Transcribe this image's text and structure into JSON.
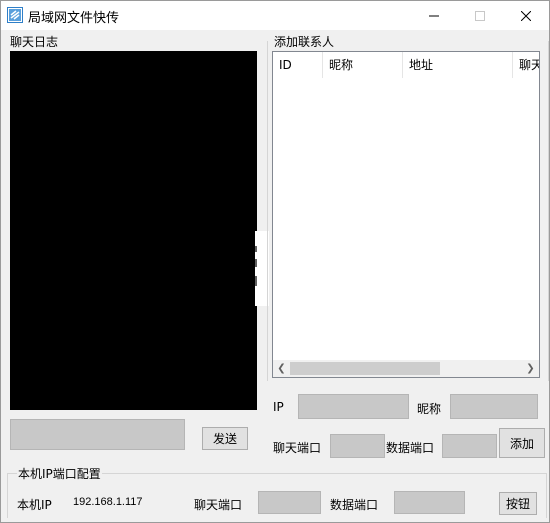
{
  "window": {
    "title": "局域网文件快传"
  },
  "chat_log": {
    "label": "聊天日志",
    "send_label": "发送"
  },
  "contacts": {
    "label": "添加联系人",
    "columns": [
      "ID",
      "昵称",
      "地址",
      "聊天"
    ],
    "ip_label": "IP",
    "nick_label": "昵称",
    "chat_port_label": "聊天端口",
    "data_port_label": "数据端口",
    "add_label": "添加"
  },
  "local_config": {
    "label": "本机IP端口配置",
    "ip_label": "本机IP",
    "ip_value": "192.168.1.117",
    "chat_port_label": "聊天端口",
    "data_port_label": "数据端口",
    "button_label": "按钮"
  },
  "icons": [
    "app-icon",
    "minimize-icon",
    "maximize-icon",
    "close-icon",
    "scroll-left-icon",
    "scroll-right-icon"
  ]
}
